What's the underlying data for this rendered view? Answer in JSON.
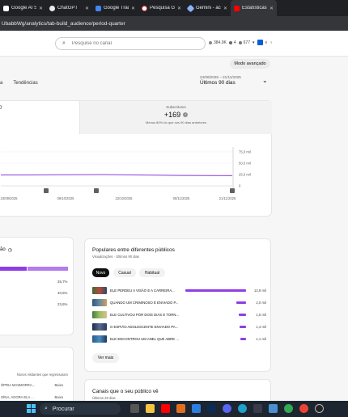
{
  "browser": {
    "tabs": [
      {
        "label": "Google AI Stu",
        "color": "#ffffff"
      },
      {
        "label": "ChatGPT",
        "color": "#e8eaed"
      },
      {
        "label": "Google Tradu",
        "color": "#4285f4"
      },
      {
        "label": "Pesquisa Goog",
        "color": "#ea4335"
      },
      {
        "label": "Gemini - acess",
        "color": "#8ab4f8"
      },
      {
        "label": "Estatísticas do",
        "color": "#ff0000"
      }
    ],
    "url": "UbabbWg/analytics/tab-build_audience/period-quarter"
  },
  "header": {
    "search_placeholder": "Pesquise no canal",
    "stats": [
      "384.9K",
      "4",
      "677"
    ]
  },
  "advanced_mode": "Modo avançado",
  "tabs_row": [
    "a",
    "Tendências"
  ],
  "period": {
    "range": "24/08/2025 – 21/11/2025",
    "label": "Últimos 90 dias"
  },
  "metric": {
    "left_value": "0",
    "label": "Subscritores",
    "value": "+169",
    "note": "Menos 80% do que nos 90 dias anteriores"
  },
  "chart_data": {
    "type": "line",
    "y_ticks": [
      "75,0 mil",
      "50,0 mil",
      "25,0 mil",
      "0"
    ],
    "x_ticks": [
      "23/09/2025",
      "08/10/2025",
      "22/10/2025",
      "06/11/2025",
      "21/11/2025"
    ],
    "series": [
      {
        "values": [
          24000,
          24200,
          24600,
          24800,
          25000,
          24400,
          23600,
          23000,
          22800,
          22500
        ]
      }
    ],
    "ylim": [
      0,
      75000
    ],
    "color": "#8f3de4"
  },
  "card2": {
    "title": "ão",
    "percents": [
      "35,7%",
      "40,5%",
      "23,6%"
    ]
  },
  "popular": {
    "title": "Populares entre diferentes públicos",
    "sub": "Visualizações · Últimos 90 dias",
    "pills": [
      "Novo",
      "Casual",
      "Habitual"
    ],
    "videos": [
      {
        "title": "ELE PERDEU A VISÃO E A CARREIRA... ",
        "value": "12,9 mil",
        "fraction": 1.0
      },
      {
        "title": "QUANDO UM CRIMINOSO É ENVIADO P...",
        "value": "2,0 mil",
        "fraction": 0.16
      },
      {
        "title": "ELE CULTIVOU POR DOIS DIAS E TORN...",
        "value": "1,6 mil",
        "fraction": 0.12
      },
      {
        "title": "O ESPIÃO ADOLESCENTE ENVIADO PA...",
        "value": "1,4 mil",
        "fraction": 0.11
      },
      {
        "title": "ELE ENCONTROU UM ANEL QUE ABRE ...",
        "value": "1,1 mil",
        "fraction": 0.09
      }
    ],
    "see_more": "Ver mais"
  },
  "card4": {
    "header": "Novos visitantes que regressaram",
    "rows": [
      {
        "name": "ÓPRIA MASMORRA...",
        "value": "Baixo"
      },
      {
        "name": "OÍNA, AGORA ELA ...",
        "value": "Baixo"
      }
    ]
  },
  "channels": {
    "title": "Canais que o seu público vê",
    "sub": "Últimos 28 dias"
  },
  "taskbar": {
    "search": "Procurar"
  }
}
